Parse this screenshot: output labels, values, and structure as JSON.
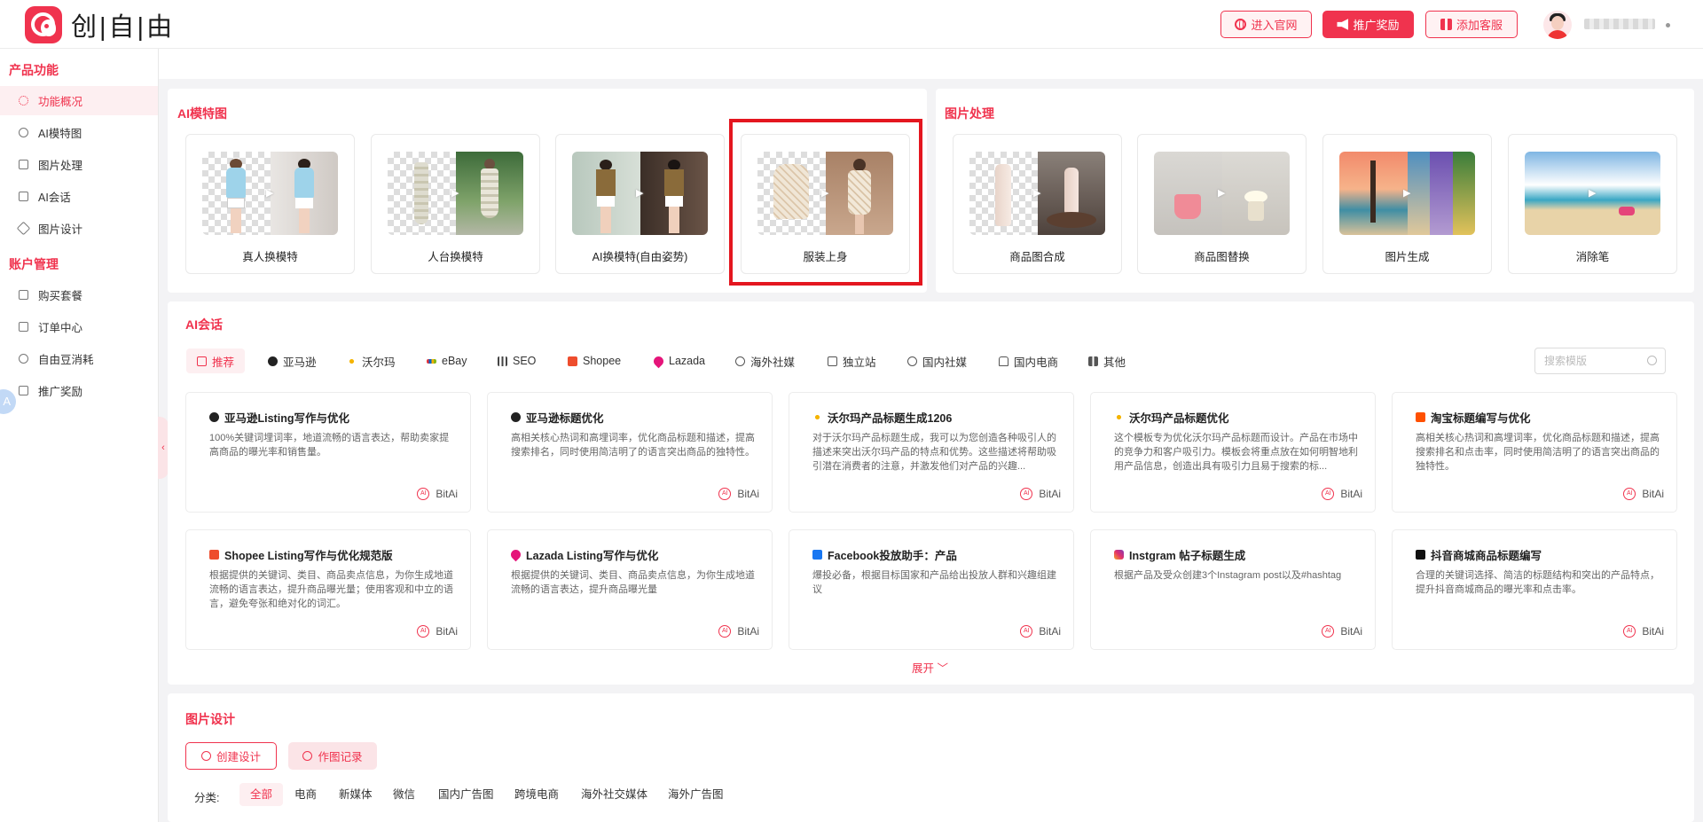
{
  "brand": {
    "name": "创|自|由",
    "accent": "#f0334e"
  },
  "header": {
    "btn_site": "进入官网",
    "btn_promo": "推广奖励",
    "btn_service": "添加客服"
  },
  "sidebar": {
    "group1": "产品功能",
    "items1": [
      "功能概况",
      "AI模特图",
      "图片处理",
      "AI会话",
      "图片设计"
    ],
    "group2": "账户管理",
    "items2": [
      "购买套餐",
      "订单中心",
      "自由豆消耗",
      "推广奖励"
    ],
    "float_letter": "A"
  },
  "ai_model": {
    "title": "AI模特图",
    "tools": [
      "真人换模特",
      "人台换模特",
      "AI换模特(自由姿势)",
      "服装上身"
    ]
  },
  "image_proc": {
    "title": "图片处理",
    "tools": [
      "商品图合成",
      "商品图替换",
      "图片生成",
      "消除笔"
    ]
  },
  "ai_chat": {
    "title": "AI会话",
    "tabs": [
      "推荐",
      "亚马逊",
      "沃尔玛",
      "eBay",
      "SEO",
      "Shopee",
      "Lazada",
      "海外社媒",
      "独立站",
      "国内社媒",
      "国内电商",
      "其他"
    ],
    "search_placeholder": "搜索模版",
    "cards": [
      {
        "title": "亚马逊Listing写作与优化",
        "desc": "100%关键词埋词率，地道流畅的语言表达，帮助卖家提高商品的曝光率和销售量。",
        "author": "BitAi"
      },
      {
        "title": "亚马逊标题优化",
        "desc": "高相关核心热词和高埋词率，优化商品标题和描述，提高搜索排名，同时使用简洁明了的语言突出商品的独特性。",
        "author": "BitAi"
      },
      {
        "title": "沃尔玛产品标题生成1206",
        "desc": "对于沃尔玛产品标题生成，我可以为您创造各种吸引人的描述来突出沃尔玛产品的特点和优势。这些描述将帮助吸引潜在消费者的注意，并激发他们对产品的兴趣...",
        "author": "BitAi"
      },
      {
        "title": "沃尔玛产品标题优化",
        "desc": "这个模板专为优化沃尔玛产品标题而设计。产品在市场中的竞争力和客户吸引力。模板会将重点放在如何明智地利用产品信息，创造出具有吸引力且易于搜索的标...",
        "author": "BitAi"
      },
      {
        "title": "淘宝标题编写与优化",
        "desc": "高相关核心热词和高埋词率，优化商品标题和描述，提高搜索排名和点击率，同时使用简洁明了的语言突出商品的独特性。",
        "author": "BitAi"
      },
      {
        "title": "Shopee Listing写作与优化规范版",
        "desc": "根据提供的关键词、类目、商品卖点信息，为你生成地道流畅的语言表达，提升商品曝光量；使用客观和中立的语言，避免夸张和绝对化的词汇。",
        "author": "BitAi"
      },
      {
        "title": "Lazada Listing写作与优化",
        "desc": "根据提供的关键词、类目、商品卖点信息，为你生成地道流畅的语言表达，提升商品曝光量",
        "author": "BitAi"
      },
      {
        "title": "Facebook投放助手：产品",
        "desc": "爆投必备，根据目标国家和产品给出投放人群和兴趣组建议",
        "author": "BitAi"
      },
      {
        "title": "Instgram 帖子标题生成",
        "desc": "根据产品及受众创建3个Instagram post以及#hashtag",
        "author": "BitAi"
      },
      {
        "title": "抖音商城商品标题编写",
        "desc": "合理的关键词选择、简洁的标题结构和突出的产品特点，提升抖音商城商品的曝光率和点击率。",
        "author": "BitAi"
      }
    ],
    "expand_label": "展开 ﹀"
  },
  "image_design": {
    "title": "图片设计",
    "btn_create": "创建设计",
    "btn_history": "作图记录",
    "category_label": "分类:",
    "categories": [
      "全部",
      "电商",
      "新媒体",
      "微信",
      "国内广告图",
      "跨境电商",
      "海外社交媒体",
      "海外广告图"
    ]
  }
}
